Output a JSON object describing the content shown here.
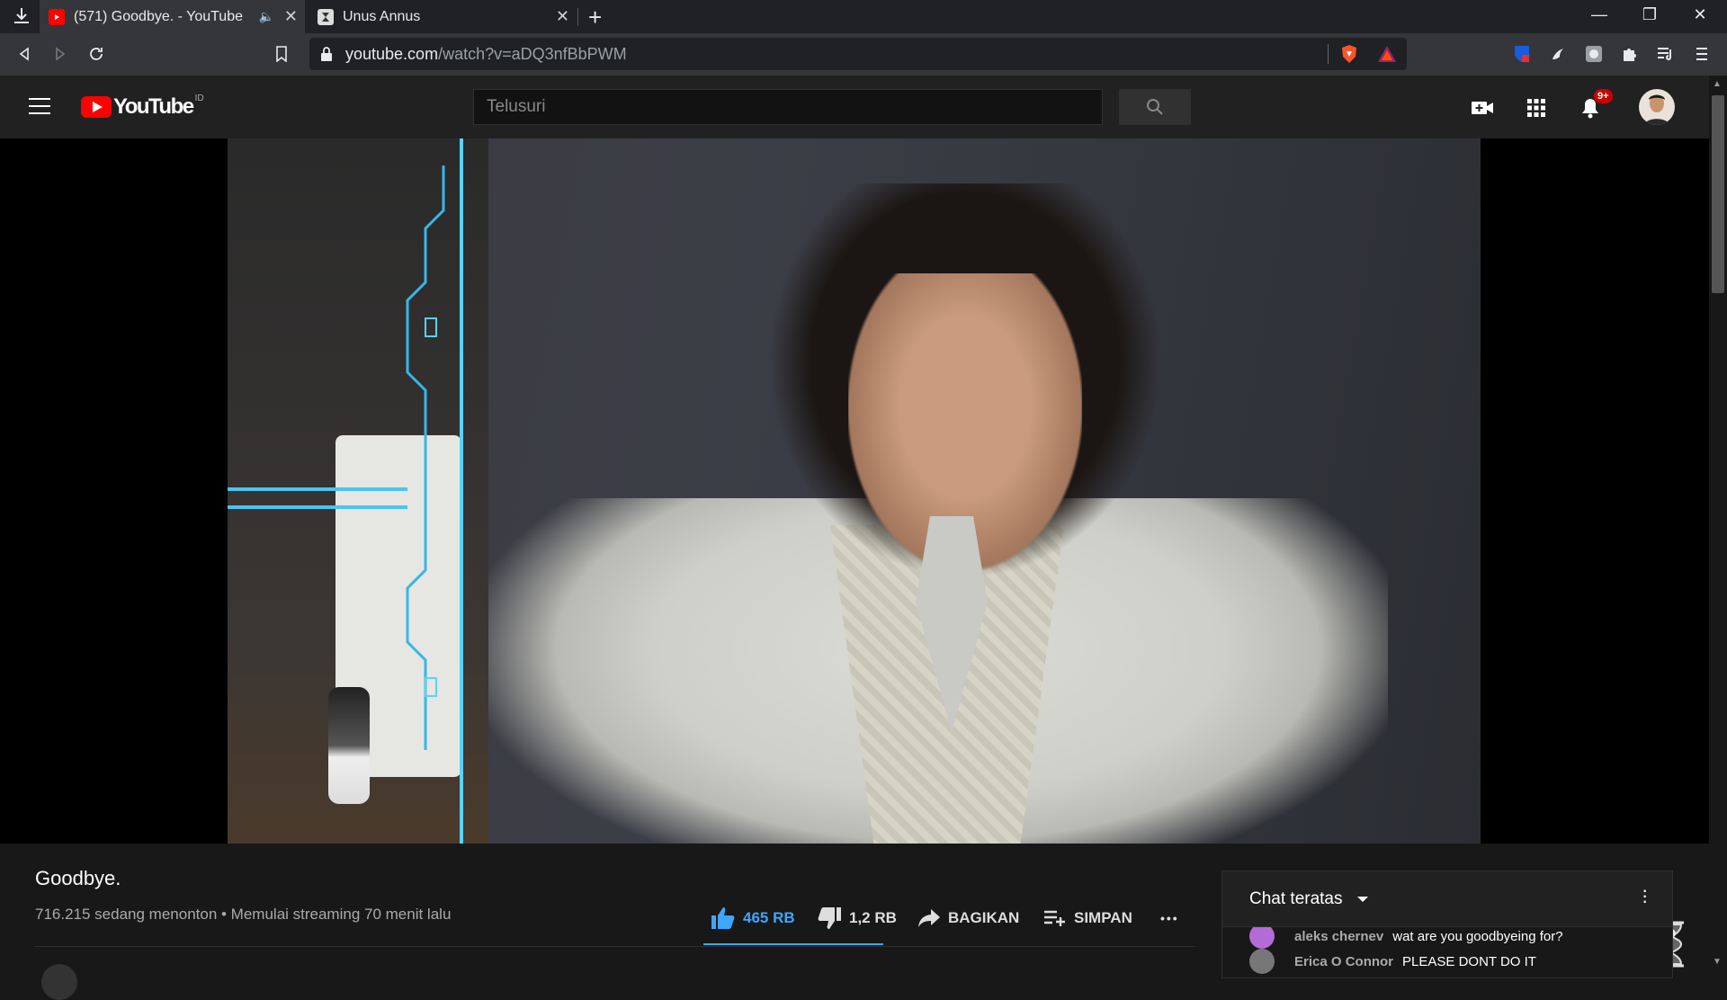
{
  "browser": {
    "tabs": [
      {
        "title": "(571) Goodbye. - YouTube",
        "active": true,
        "muted_icon": "speaker-icon"
      },
      {
        "title": "Unus Annus",
        "active": false
      }
    ],
    "url_host": "youtube.com",
    "url_path": "/watch?v=aDQ3nfBbPWM"
  },
  "youtube": {
    "logo_text": "YouTube",
    "country_code": "ID",
    "search_placeholder": "Telusuri",
    "notification_badge": "9+"
  },
  "video": {
    "title": "Goodbye.",
    "meta": "716.215 sedang menonton • Memulai streaming 70 menit lalu",
    "likes": "465 RB",
    "dislikes": "1,2 RB",
    "share_label": "BAGIKAN",
    "save_label": "SIMPAN",
    "more_label": "•••"
  },
  "chat": {
    "title": "Chat teratas",
    "messages": [
      {
        "author": "aleks chernev",
        "text": "wat are you goodbyeing for?",
        "avatar_color": "#b36bd6"
      },
      {
        "author": "Erica O Connor",
        "text": "PLEASE DONT DO IT",
        "avatar_color": "#777777"
      }
    ]
  },
  "colors": {
    "accent_blue": "#3ea6ff",
    "youtube_red": "#ff0000",
    "background": "#181818"
  }
}
